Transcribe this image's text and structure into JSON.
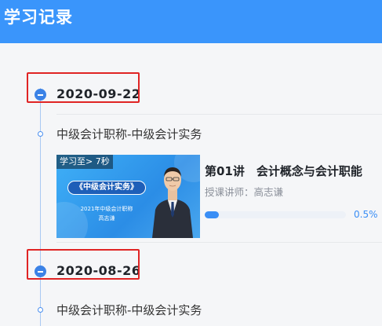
{
  "header": {
    "title": "学习记录"
  },
  "records": [
    {
      "date": "2020-09-22",
      "course_name": "中级会计职称-中级会计实务",
      "lesson": {
        "watched_badge": "学习至> 7秒",
        "thumb_title": "《中级会计实务》",
        "thumb_subtitle": "2021年中级会计职称",
        "thumb_teacher": "高志谦",
        "title": "第01讲　会计概念与会计职能",
        "teacher": "授课讲师：高志谦",
        "progress_text": "0.5%",
        "progress_fraction": 0.005
      }
    },
    {
      "date": "2020-08-26",
      "course_name": "中级会计职称-中级会计实务"
    }
  ],
  "colors": {
    "header_bg": "#3a95fb",
    "accent": "#3a8ef5",
    "highlight_box": "#e02424"
  },
  "icons": {
    "date_marker": "minus-circle-icon",
    "course_marker": "small-circle-icon"
  }
}
